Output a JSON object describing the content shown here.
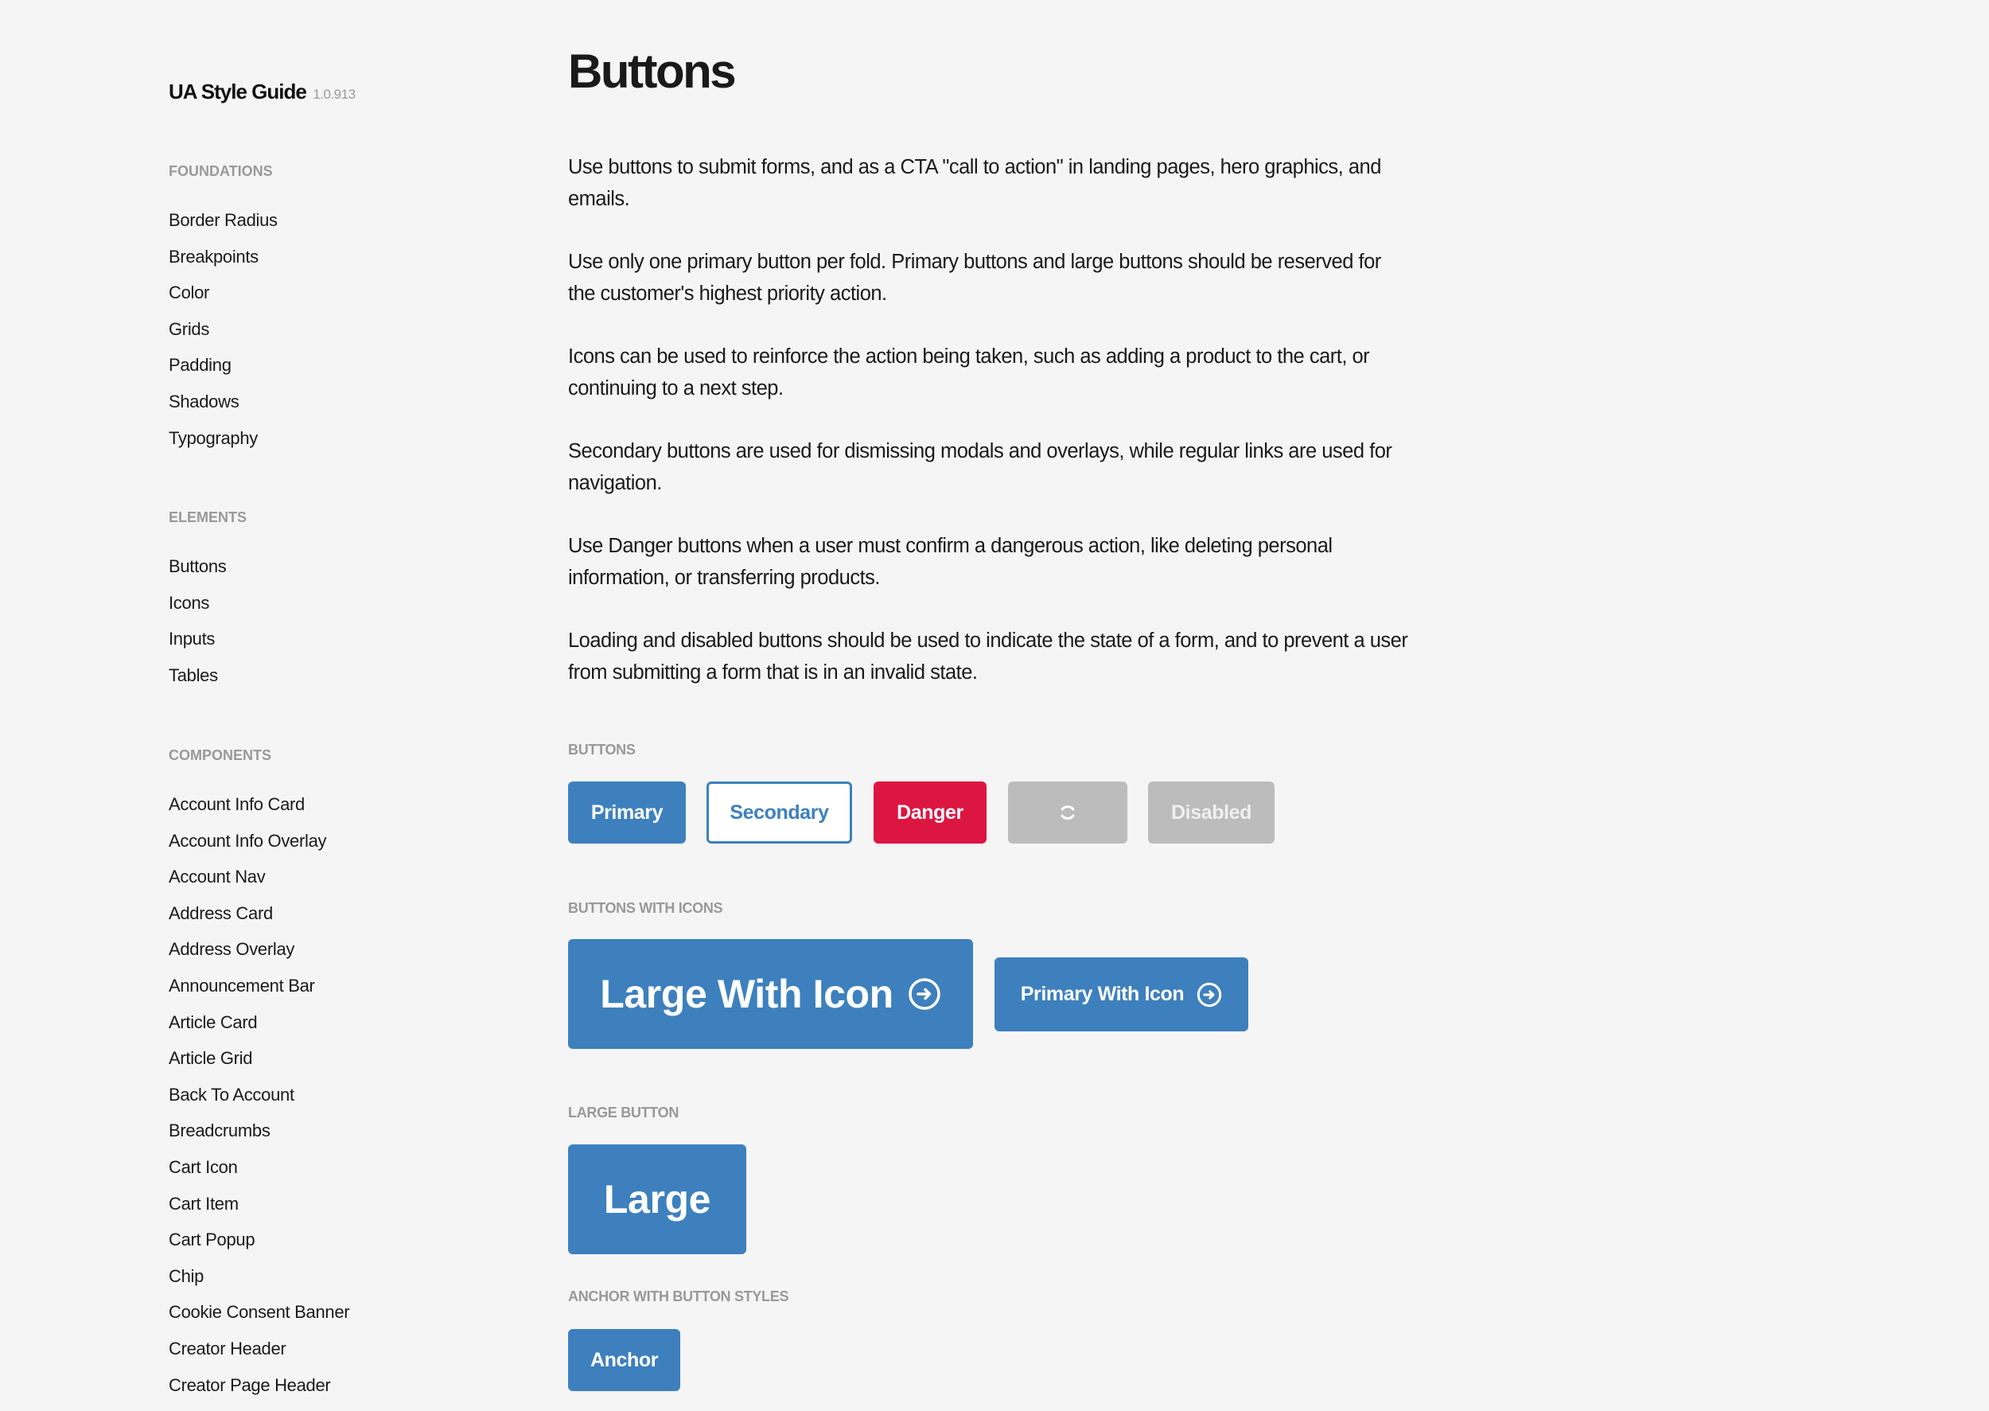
{
  "brand": {
    "title": "UA Style Guide",
    "version": "1.0.913"
  },
  "sidebar": {
    "groups": [
      {
        "heading": "FOUNDATIONS",
        "items": [
          "Border Radius",
          "Breakpoints",
          "Color",
          "Grids",
          "Padding",
          "Shadows",
          "Typography"
        ]
      },
      {
        "heading": "ELEMENTS",
        "items": [
          "Buttons",
          "Icons",
          "Inputs",
          "Tables"
        ]
      },
      {
        "heading": "COMPONENTS",
        "items": [
          "Account Info Card",
          "Account Info Overlay",
          "Account Nav",
          "Address Card",
          "Address Overlay",
          "Announcement Bar",
          "Article Card",
          "Article Grid",
          "Back To Account",
          "Breadcrumbs",
          "Cart Icon",
          "Cart Item",
          "Cart Popup",
          "Chip",
          "Cookie Consent Banner",
          "Creator Header",
          "Creator Page Header"
        ]
      }
    ]
  },
  "main": {
    "title": "Buttons",
    "paragraphs": [
      "Use buttons to submit forms, and as a CTA \"call to action\" in landing pages, hero graphics, and emails.",
      "Use only one primary button per fold. Primary buttons and large buttons should be reserved for the customer's highest priority action.",
      "Icons can be used to reinforce the action being taken, such as adding a product to the cart, or continuing to a next step.",
      "Secondary buttons are used for dismissing modals and overlays, while regular links are used for navigation.",
      "Use Danger buttons when a user must confirm a dangerous action, like deleting personal information, or transferring products.",
      "Loading and disabled buttons should be used to indicate the state of a form, and to prevent a user from submitting a form that is in an invalid state."
    ],
    "sections": {
      "buttons": {
        "label": "BUTTONS",
        "primary": "Primary",
        "secondary": "Secondary",
        "danger": "Danger",
        "loading_icon": "spinner-icon",
        "disabled": "Disabled"
      },
      "buttons_with_icons": {
        "label": "BUTTONS WITH ICONS",
        "large": "Large With Icon",
        "primary": "Primary With Icon",
        "icon": "arrow-right-circle-icon"
      },
      "large_button": {
        "label": "LARGE BUTTON",
        "button": "Large"
      },
      "anchor": {
        "label": "ANCHOR WITH BUTTON STYLES",
        "button": "Anchor"
      }
    }
  },
  "colors": {
    "background": "#f5f5f5",
    "primary": "#3d80bd",
    "danger": "#dd1541",
    "disabled": "#bcbcbc",
    "muted_text": "#999999",
    "text": "#1a1a1a"
  }
}
